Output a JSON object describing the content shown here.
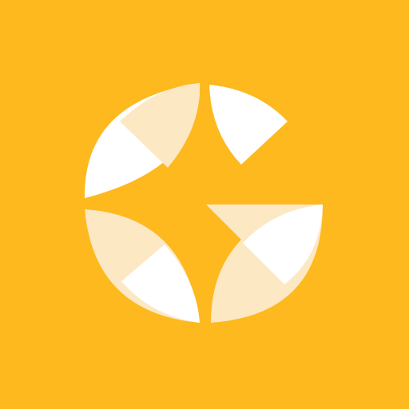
{
  "icon": {
    "name": "g-logo-icon",
    "colors": {
      "background": "#FDB91E",
      "petal_white": "#FFFFFF",
      "petal_cream": "#FDE8C4"
    }
  }
}
